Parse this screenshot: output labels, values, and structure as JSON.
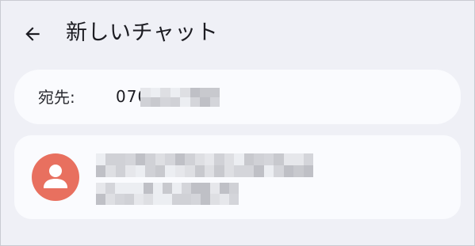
{
  "app_bar": {
    "back_icon": "arrow-left-icon",
    "title": "新しいチャット"
  },
  "recipient_field": {
    "label": "宛先:",
    "value": "070"
  },
  "contact_suggestion": {
    "avatar_icon": "person-icon",
    "avatar_color": "#e8705f"
  }
}
